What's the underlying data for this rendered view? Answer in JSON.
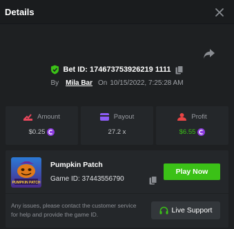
{
  "header": {
    "title": "Details"
  },
  "bet": {
    "id_text": "Bet ID: 174673753926219 1111",
    "by_label": "By",
    "user": "Mila Bar",
    "on_label": "On",
    "date": "10/15/2022, 7:25:28 AM"
  },
  "stats": [
    {
      "label": "Amount",
      "value": "$0.25",
      "icon": "amount-icon",
      "color": "#e8475c"
    },
    {
      "label": "Payout",
      "value": "27.2 x",
      "icon": "payout-icon",
      "color": "#8d5cf6"
    },
    {
      "label": "Profit",
      "value": "$6.55",
      "icon": "profit-icon",
      "color": "#e84545"
    }
  ],
  "game": {
    "name": "Pumpkin Patch",
    "id_text": "Game ID: 37443556790",
    "play_label": "Play Now",
    "thumb_text": "PUMPKIN PATCH"
  },
  "support": {
    "text": "Any issues, please contact the customer service for help and provide the game ID.",
    "button_label": "Live Support"
  },
  "colors": {
    "accent_green": "#3bc117",
    "coin_purple": "#8d3be0",
    "background": "#1e2022",
    "card": "#24272a"
  }
}
